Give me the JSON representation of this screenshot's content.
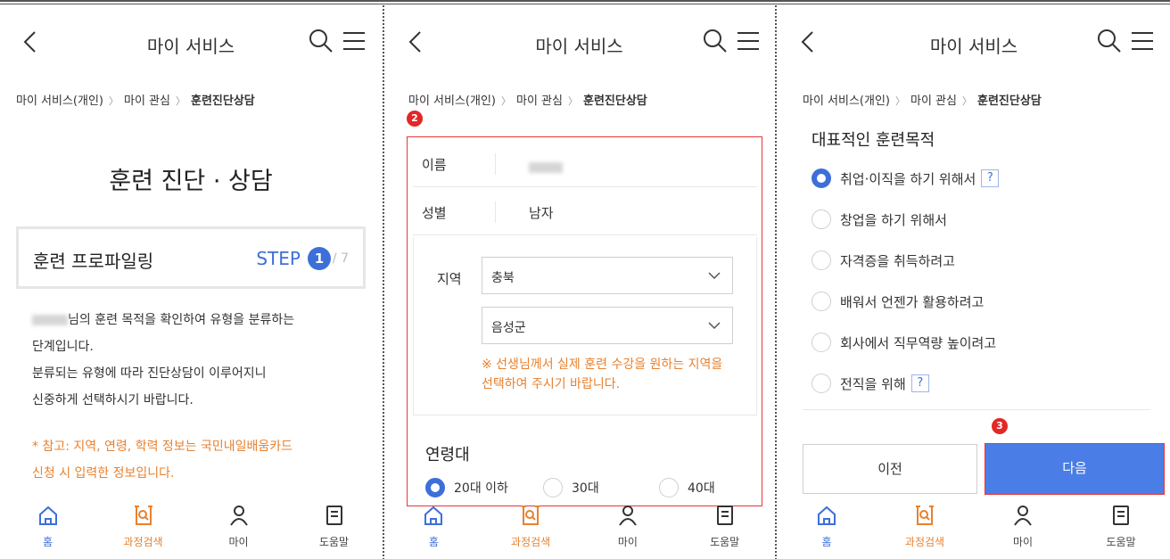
{
  "screens": [
    {
      "header": {
        "title": "마이 서비스"
      },
      "breadcrumb": [
        "마이 서비스(개인)",
        "마이 관심",
        "훈련진단상담"
      ],
      "page_title": "훈련 진단 · 상담",
      "profile": {
        "label": "훈련 프로파일링",
        "step_text": "STEP",
        "step_current": "1",
        "step_total": "/ 7"
      },
      "description": {
        "line1_suffix": "님의 훈련 목적을 확인하여 유형을 분류하는",
        "line2": "단계입니다.",
        "line3": "분류되는 유형에 따라 진단상담이 이루어지니",
        "line4": "신중하게 선택하시기 바랍니다."
      },
      "note": {
        "line1": "* 참고: 지역, 연령, 학력 정보는 국민내일배움카드",
        "line2": "신청 시 입력한 정보입니다."
      }
    },
    {
      "header": {
        "title": "마이 서비스"
      },
      "breadcrumb": [
        "마이 서비스(개인)",
        "마이 관심",
        "훈련진단상담"
      ],
      "badge": "2",
      "fields": {
        "name_label": "이름",
        "gender_label": "성별",
        "gender_value": "남자",
        "region_label": "지역",
        "region_province": "충북",
        "region_city": "음성군",
        "region_warning_line1": "※ 선생님께서 실제 훈련 수강을 원하는 지역을",
        "region_warning_line2": "선택하여 주시기 바랍니다."
      },
      "age": {
        "title": "연령대",
        "options": [
          "20대 이하",
          "30대",
          "40대"
        ],
        "selected": "20대 이하"
      }
    },
    {
      "header": {
        "title": "마이 서비스"
      },
      "breadcrumb": [
        "마이 서비스(개인)",
        "마이 관심",
        "훈련진단상담"
      ],
      "purpose_title": "대표적인 훈련목적",
      "purposes": [
        {
          "label": "취업·이직을 하기 위해서",
          "help": "?"
        },
        {
          "label": "창업을 하기 위해서"
        },
        {
          "label": "자격증을 취득하려고"
        },
        {
          "label": "배워서 언젠가 활용하려고"
        },
        {
          "label": "회사에서 직무역량 높이려고"
        },
        {
          "label": "전직을 위해",
          "help": "?"
        }
      ],
      "selected_purpose": "취업·이직을 하기 위해서",
      "badge": "3",
      "buttons": {
        "prev": "이전",
        "next": "다음"
      }
    }
  ],
  "tabbar": [
    {
      "label": "홈",
      "icon": "home-icon"
    },
    {
      "label": "과정검색",
      "icon": "course-search-icon"
    },
    {
      "label": "마이",
      "icon": "person-icon"
    },
    {
      "label": "도움말",
      "icon": "help-doc-icon"
    }
  ],
  "colors": {
    "accent": "#3d6fd8",
    "orange": "#e8812f",
    "highlight_red": "#e4373b",
    "next_button": "#4a7ee6"
  }
}
